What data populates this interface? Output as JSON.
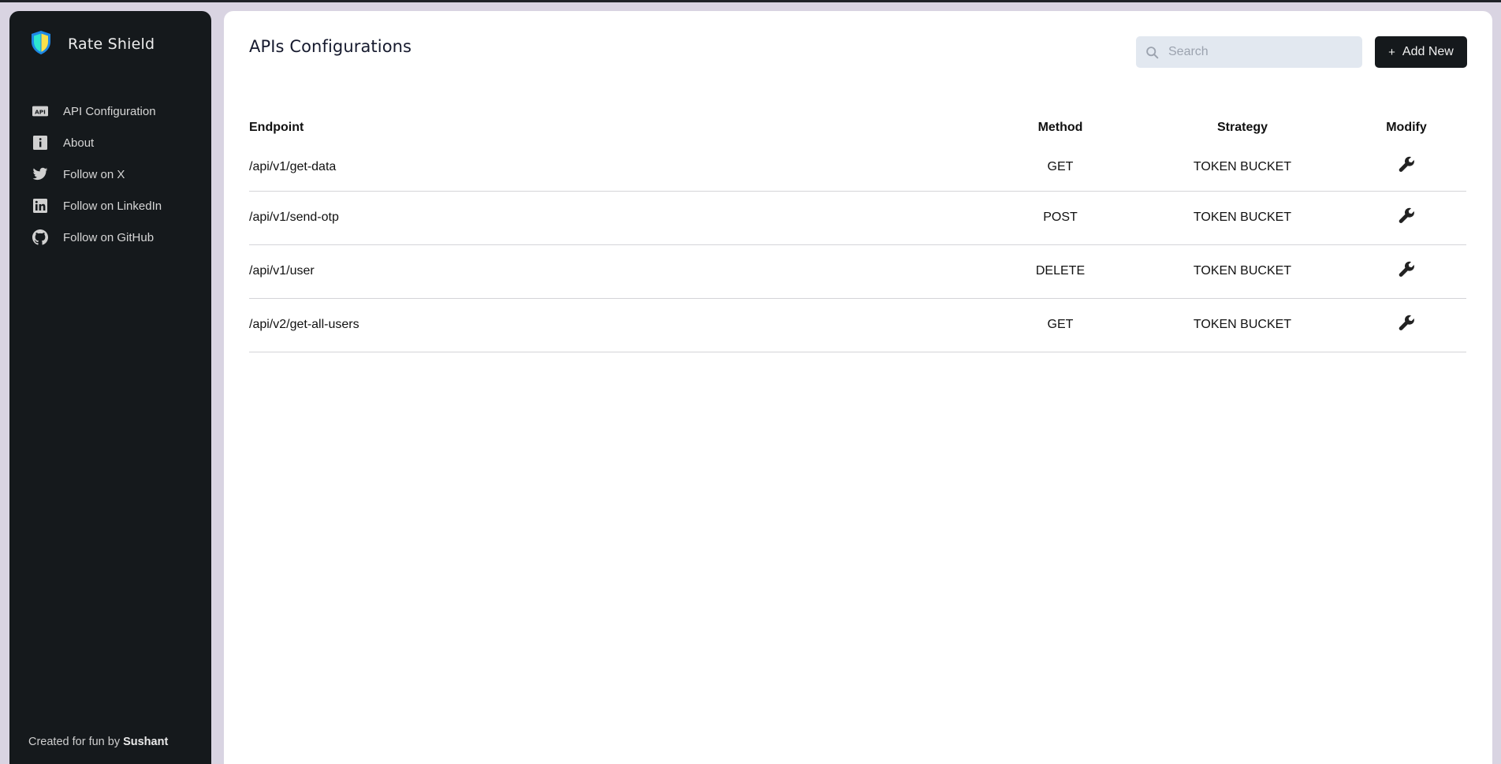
{
  "app": {
    "name": "Rate Shield",
    "colors": {
      "sidebar_bg": "#15191c",
      "page_bg": "#d9d4e2",
      "shield_outline": "#1e88e5",
      "shield_left": "#2ee6d0",
      "shield_right": "#f9e04b",
      "button_bg": "#15191c",
      "search_bg": "#e2e8f0"
    }
  },
  "sidebar": {
    "items": [
      {
        "label": "API Configuration",
        "icon": "api-icon"
      },
      {
        "label": "About",
        "icon": "info-icon"
      },
      {
        "label": "Follow on X",
        "icon": "twitter-icon"
      },
      {
        "label": "Follow on LinkedIn",
        "icon": "linkedin-icon"
      },
      {
        "label": "Follow on GitHub",
        "icon": "github-icon"
      }
    ],
    "footer": {
      "prefix": "Created for fun by ",
      "author": "Sushant"
    }
  },
  "main": {
    "title": "APIs Configurations",
    "search": {
      "placeholder": "Search",
      "value": ""
    },
    "add_button": {
      "plus": "+",
      "label": "Add New"
    },
    "table": {
      "columns": [
        "Endpoint",
        "Method",
        "Strategy",
        "Modify"
      ],
      "rows": [
        {
          "endpoint": "/api/v1/get-data",
          "method": "GET",
          "strategy": "TOKEN BUCKET"
        },
        {
          "endpoint": "/api/v1/send-otp",
          "method": "POST",
          "strategy": "TOKEN BUCKET"
        },
        {
          "endpoint": "/api/v1/user",
          "method": "DELETE",
          "strategy": "TOKEN BUCKET"
        },
        {
          "endpoint": "/api/v2/get-all-users",
          "method": "GET",
          "strategy": "TOKEN BUCKET"
        }
      ]
    }
  }
}
